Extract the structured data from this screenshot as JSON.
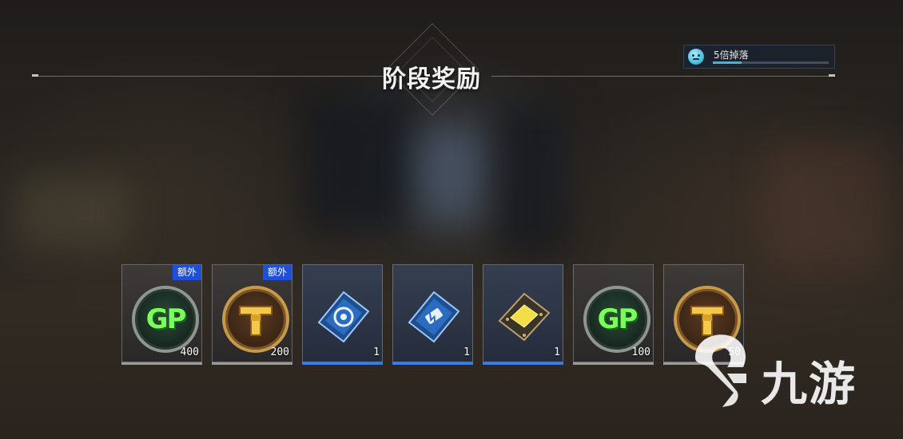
{
  "header": {
    "title": "阶段奖励"
  },
  "buff": {
    "label": "5倍掉落",
    "progress_fraction": 0.25,
    "icon": "smiley-face-icon"
  },
  "colors": {
    "extra_badge": "#1f4fd6",
    "blue_slot_bar": "#3b7de0",
    "gp_green": "#7bff5c",
    "gold": "#c69a4a"
  },
  "rewards": [
    {
      "icon": "gp-coin-icon",
      "count": "400",
      "badge": "额外",
      "style": "grey"
    },
    {
      "icon": "t-coin-icon",
      "count": "200",
      "badge": "额外",
      "style": "grey"
    },
    {
      "icon": "blue-chip-gear-icon",
      "count": "1",
      "badge": "",
      "style": "blue"
    },
    {
      "icon": "blue-chip-battery-icon",
      "count": "1",
      "badge": "",
      "style": "blue"
    },
    {
      "icon": "gold-chip-icon",
      "count": "1",
      "badge": "",
      "style": "blue"
    },
    {
      "icon": "gp-coin-icon",
      "count": "100",
      "badge": "",
      "style": "grey"
    },
    {
      "icon": "t-coin-icon",
      "count": "50",
      "badge": "",
      "style": "grey"
    }
  ],
  "watermark": {
    "text": "九游"
  }
}
